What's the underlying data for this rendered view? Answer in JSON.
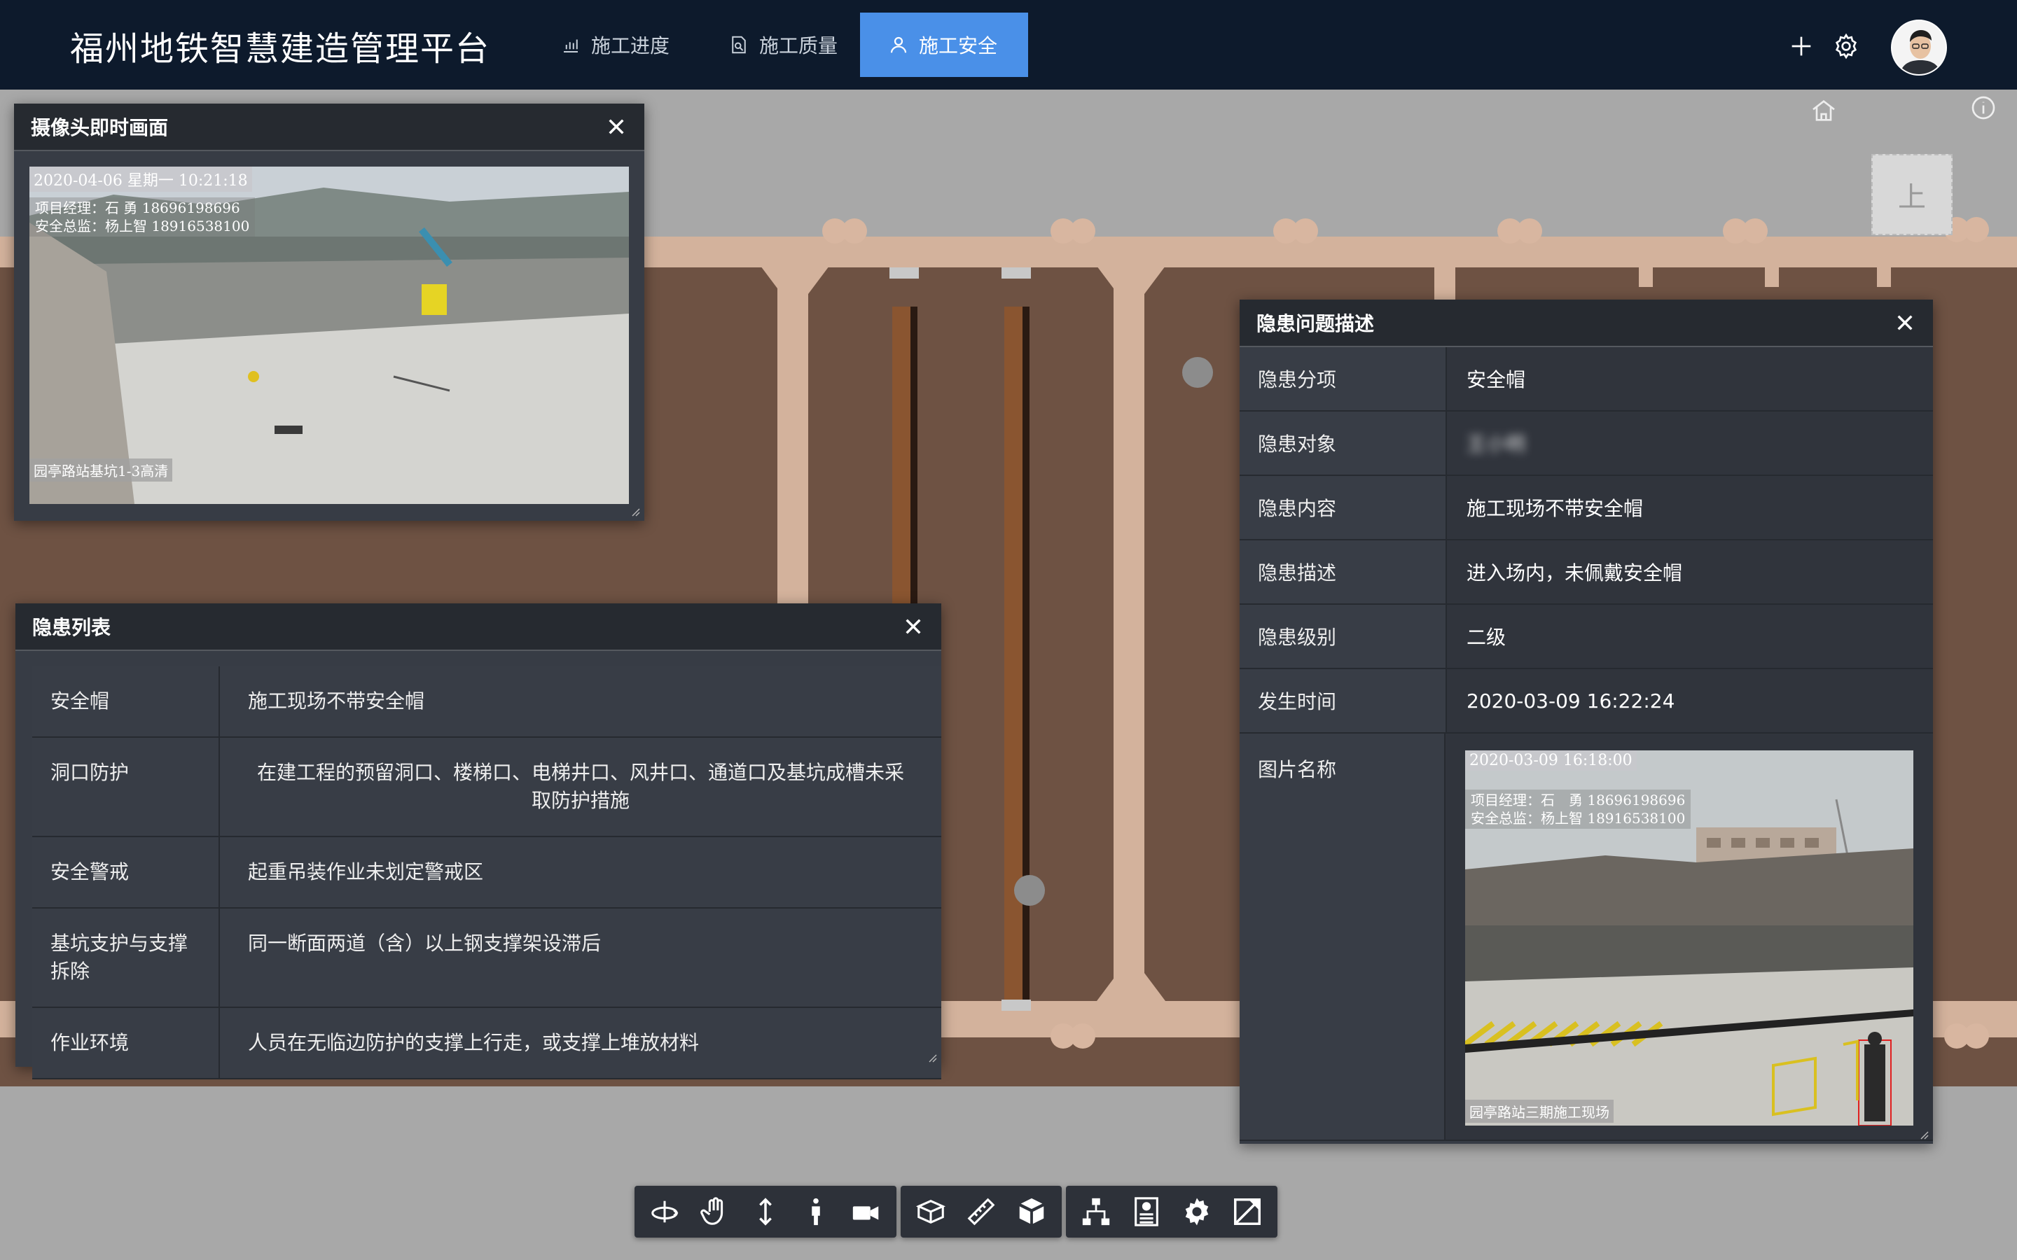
{
  "header": {
    "app_title": "福州地铁智慧建造管理平台",
    "tabs": [
      {
        "label": "施工进度",
        "icon": "bar-chart-icon",
        "active": false
      },
      {
        "label": "施工质量",
        "icon": "document-search-icon",
        "active": false
      },
      {
        "label": "施工安全",
        "icon": "user-icon",
        "active": true
      }
    ],
    "icons": [
      "plus-icon",
      "gear-icon"
    ],
    "accent_color": "#4a90e8",
    "bar_color": "#0d1a2c"
  },
  "scene": {
    "view_cube_label": "上",
    "icons": [
      "home-icon",
      "info-icon"
    ]
  },
  "camera_panel": {
    "title": "摄像头即时画面",
    "timestamp": "2020-04-06 星期一  10:21:18",
    "overlay_line1": "项目经理：石 勇 18696198696",
    "overlay_line2": "安全总监：杨上智 18916538100",
    "camera_label": "园亭路站基坑1-3高清"
  },
  "hazard_list": {
    "title": "隐患列表",
    "rows": [
      {
        "category": "安全帽",
        "content": "施工现场不带安全帽"
      },
      {
        "category": "洞口防护",
        "content": "在建工程的预留洞口、楼梯口、电梯井口、风井口、通道口及基坑成槽未采取防护措施"
      },
      {
        "category": "安全警戒",
        "content": "起重吊装作业未划定警戒区"
      },
      {
        "category": "基坑支护与支撑拆除",
        "content": "同一断面两道（含）以上钢支撑架设滞后"
      },
      {
        "category": "作业环境",
        "content": "人员在无临边防护的支撑上行走，或支撑上堆放材料"
      }
    ]
  },
  "hazard_detail": {
    "title": "隐患问题描述",
    "fields": [
      {
        "key": "隐患分项",
        "value": "安全帽"
      },
      {
        "key": "隐患对象",
        "value": "王小明"
      },
      {
        "key": "隐患内容",
        "value": "施工现场不带安全帽"
      },
      {
        "key": "隐患描述",
        "value": "进入场内，未佩戴安全帽"
      },
      {
        "key": "隐患级别",
        "value": "二级"
      },
      {
        "key": "发生时间",
        "value": "2020-03-09 16:22:24"
      }
    ],
    "photo_key": "图片名称",
    "photo": {
      "timestamp": "2020-03-09  16:18:00",
      "overlay_line1": "项目经理：石　勇    18696198696",
      "overlay_line2": "安全总监：杨上智    18916538100",
      "label": "园亭路站三期施工现场"
    }
  },
  "toolbar": {
    "groups": [
      [
        "orbit-icon",
        "pan-hand-icon",
        "vertical-move-icon",
        "walk-person-icon",
        "camera-icon"
      ],
      [
        "section-box-icon",
        "measure-ruler-icon",
        "explode-cube-icon"
      ],
      [
        "model-tree-icon",
        "properties-icon",
        "settings-gear-icon",
        "fullscreen-icon"
      ]
    ]
  }
}
